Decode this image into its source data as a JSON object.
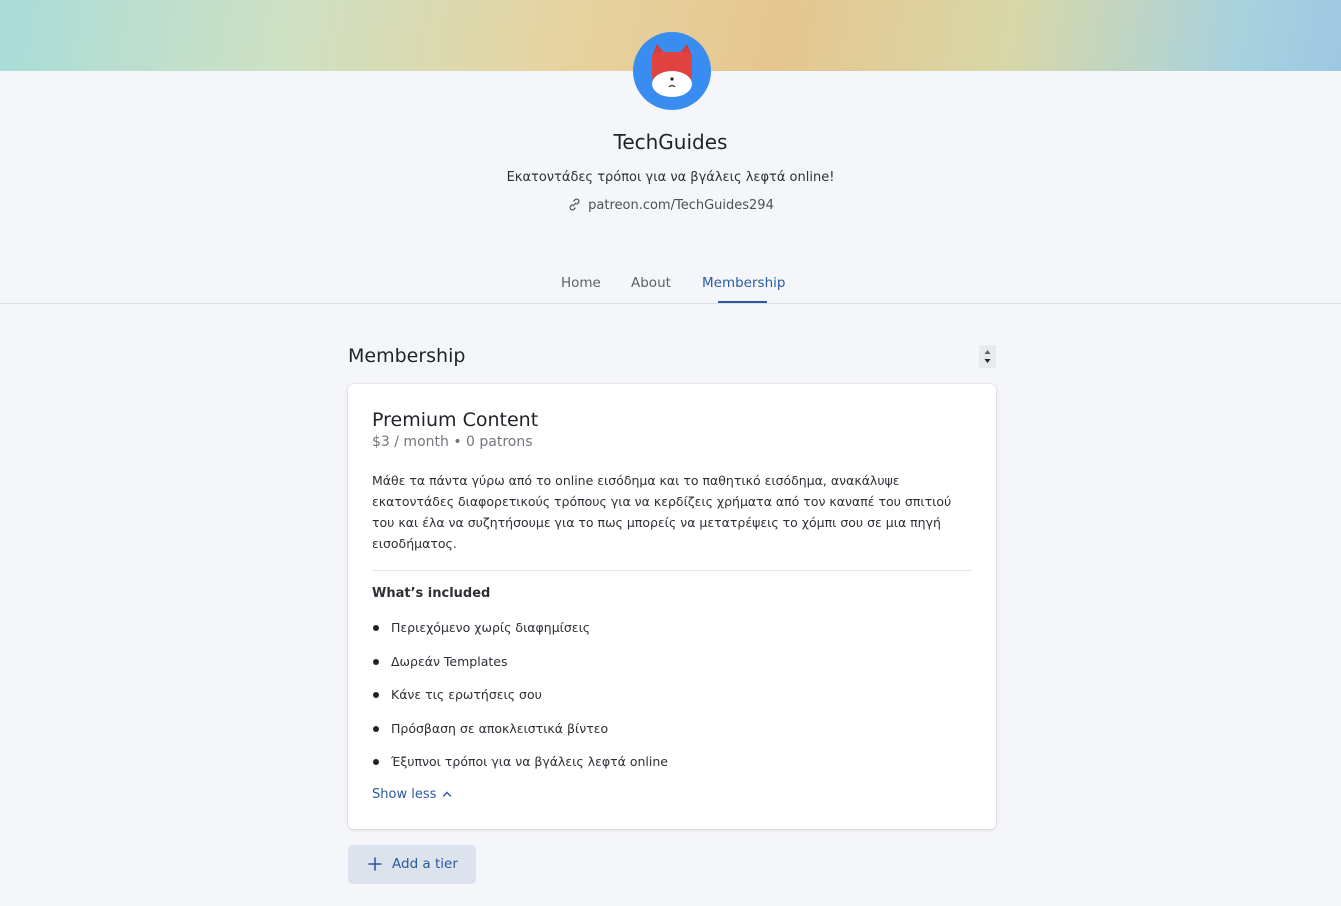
{
  "colors": {
    "accent": "#2a5aa0",
    "avatar_bg": "#3a8df0",
    "page_bg": "#f5f6fa"
  },
  "profile": {
    "avatar_icon": "fox-mascot-icon",
    "name": "TechGuides",
    "tagline": "Εκατοντάδες τρόποι για να βγάλεις λεφτά online!",
    "link_icon": "link-icon",
    "link": "patreon.com/TechGuides294"
  },
  "tabs": [
    {
      "label": "Home",
      "active": false
    },
    {
      "label": "About",
      "active": false
    },
    {
      "label": "Membership",
      "active": true
    }
  ],
  "membership": {
    "title": "Membership",
    "tier": {
      "name": "Premium Content",
      "price": "$3 / month • 0 patrons",
      "description": "Μάθε τα πάντα γύρω από το online εισόδημα και το παθητικό εισόδημα, ανακάλυψε εκατοντάδες διαφορετικούς τρόπους για να κερδίζεις χρήματα από τον καναπέ του σπιτιού του και έλα να συζητήσουμε για το πως μπορείς να μετατρέψεις το χόμπι σου σε μια πηγή εισοδήματος.",
      "included_title": "What’s included",
      "benefits": [
        "Περιεχόμενο χωρίς διαφημίσεις",
        "Δωρεάν Templates",
        "Κάνε τις ερωτήσεις σου",
        "Πρόσβαση σε αποκλειστικά βίντεο",
        "Έξυπνοι τρόποι για να βγάλεις λεφτά online"
      ],
      "show_less": "Show less"
    },
    "add_tier": "Add a tier"
  }
}
